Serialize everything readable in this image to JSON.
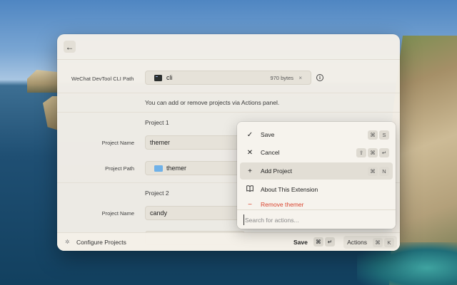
{
  "header": {
    "back_icon": "arrow-left-icon"
  },
  "cli": {
    "label": "WeChat DevTool CLI Path",
    "file_name": "cli",
    "file_size": "970 bytes",
    "clear": "×",
    "info": "i"
  },
  "help_text": "You can add or remove projects via Actions panel.",
  "projects": [
    {
      "title": "Project 1",
      "name_label": "Project Name",
      "name_value": "themer",
      "path_label": "Project Path",
      "path_value": "themer"
    },
    {
      "title": "Project 2",
      "name_label": "Project Name",
      "name_value": "candy"
    }
  ],
  "footer": {
    "icon": "✲",
    "title": "Configure Projects",
    "save_label": "Save",
    "save_keys": [
      "⌘",
      "↵"
    ],
    "actions_label": "Actions",
    "actions_keys": [
      "⌘",
      "K"
    ]
  },
  "menu": {
    "items": [
      {
        "icon": "✓",
        "label": "Save",
        "keys": [
          "⌘",
          "S"
        ]
      },
      {
        "icon": "✕",
        "label": "Cancel",
        "keys": [
          "⇧",
          "⌘",
          "↵"
        ]
      },
      {
        "icon": "+",
        "label": "Add Project",
        "keys": [
          "⌘",
          "N"
        ]
      },
      {
        "icon": "book-icon",
        "label": "About This Extension",
        "keys": []
      },
      {
        "icon": "−",
        "label": "Remove themer",
        "keys": []
      }
    ],
    "search_placeholder": "Search for actions...",
    "danger_color": "#d9452f"
  }
}
